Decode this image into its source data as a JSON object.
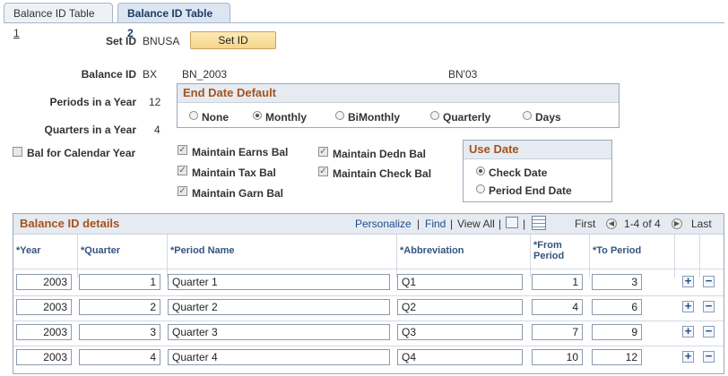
{
  "tabs": [
    {
      "label": "Balance ID Table ",
      "accel": "1"
    },
    {
      "label": "Balance ID Table 2"
    }
  ],
  "fields": {
    "set_id_label": "Set ID",
    "set_id_value": "BNUSA",
    "set_id_button": "Set ID",
    "balance_id_label": "Balance ID",
    "balance_id_value": "BX",
    "balance_id_descr": "BN_2003",
    "balance_id_short": "BN'03",
    "periods_label": "Periods in a Year",
    "periods_value": "12",
    "quarters_label": "Quarters in a Year",
    "quarters_value": "4",
    "bal_calendar_label": "Bal for Calendar Year"
  },
  "end_date_default": {
    "title": "End Date Default",
    "options": [
      "None",
      "Monthly",
      "BiMonthly",
      "Quarterly",
      "Days"
    ],
    "selected": "Monthly"
  },
  "maintain": {
    "earns": "Maintain Earns Bal",
    "dedn": "Maintain Dedn Bal",
    "tax": "Maintain Tax Bal",
    "check": "Maintain Check Bal",
    "garn": "Maintain Garn Bal"
  },
  "use_date": {
    "title": "Use Date",
    "options": [
      "Check Date",
      "Period End Date"
    ],
    "selected": "Check Date"
  },
  "grid": {
    "title": "Balance ID details",
    "personalize": "Personalize",
    "find": "Find",
    "view_all": "View All",
    "first": "First",
    "range": "1-4 of 4",
    "last": "Last",
    "columns": [
      "*Year",
      "*Quarter",
      "*Period Name",
      "*Abbreviation",
      "*From Period",
      "*To Period"
    ],
    "columns_split": {
      "from_1": "*From",
      "from_2": "Period"
    },
    "rows": [
      {
        "year": "2003",
        "quarter": "1",
        "name": "Quarter 1",
        "abbr": "Q1",
        "from": "1",
        "to": "3"
      },
      {
        "year": "2003",
        "quarter": "2",
        "name": "Quarter 2",
        "abbr": "Q2",
        "from": "4",
        "to": "6"
      },
      {
        "year": "2003",
        "quarter": "3",
        "name": "Quarter 3",
        "abbr": "Q3",
        "from": "7",
        "to": "9"
      },
      {
        "year": "2003",
        "quarter": "4",
        "name": "Quarter 4",
        "abbr": "Q4",
        "from": "10",
        "to": "12"
      }
    ]
  },
  "colors": {
    "accent_title": "#a7521c",
    "link": "#1f4d8c",
    "button": "#f6d58c"
  }
}
